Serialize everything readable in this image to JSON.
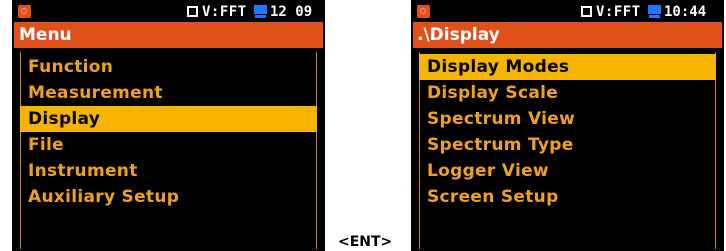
{
  "left_screen": {
    "status": {
      "mode": "V:FFT",
      "time": "12 09"
    },
    "title": "Menu",
    "items": [
      {
        "label": "Function",
        "selected": false
      },
      {
        "label": "Measurement",
        "selected": false
      },
      {
        "label": "Display",
        "selected": true
      },
      {
        "label": "File",
        "selected": false
      },
      {
        "label": "Instrument",
        "selected": false
      },
      {
        "label": "Auxiliary Setup",
        "selected": false
      }
    ]
  },
  "transition": {
    "key_label": "<ENT>"
  },
  "right_screen": {
    "status": {
      "mode": "V:FFT",
      "time": "10:44"
    },
    "title": ".\\Display",
    "items": [
      {
        "label": "Display Modes",
        "selected": true
      },
      {
        "label": "Display Scale",
        "selected": false
      },
      {
        "label": "Spectrum View",
        "selected": false
      },
      {
        "label": "Spectrum Type",
        "selected": false
      },
      {
        "label": "Logger View",
        "selected": false
      },
      {
        "label": "Screen Setup",
        "selected": false
      }
    ]
  },
  "colors": {
    "title_bar": "#e0501a",
    "menu_text": "#f0a020",
    "selection": "#f5b400",
    "monitor_icon": "#1e78ff"
  }
}
